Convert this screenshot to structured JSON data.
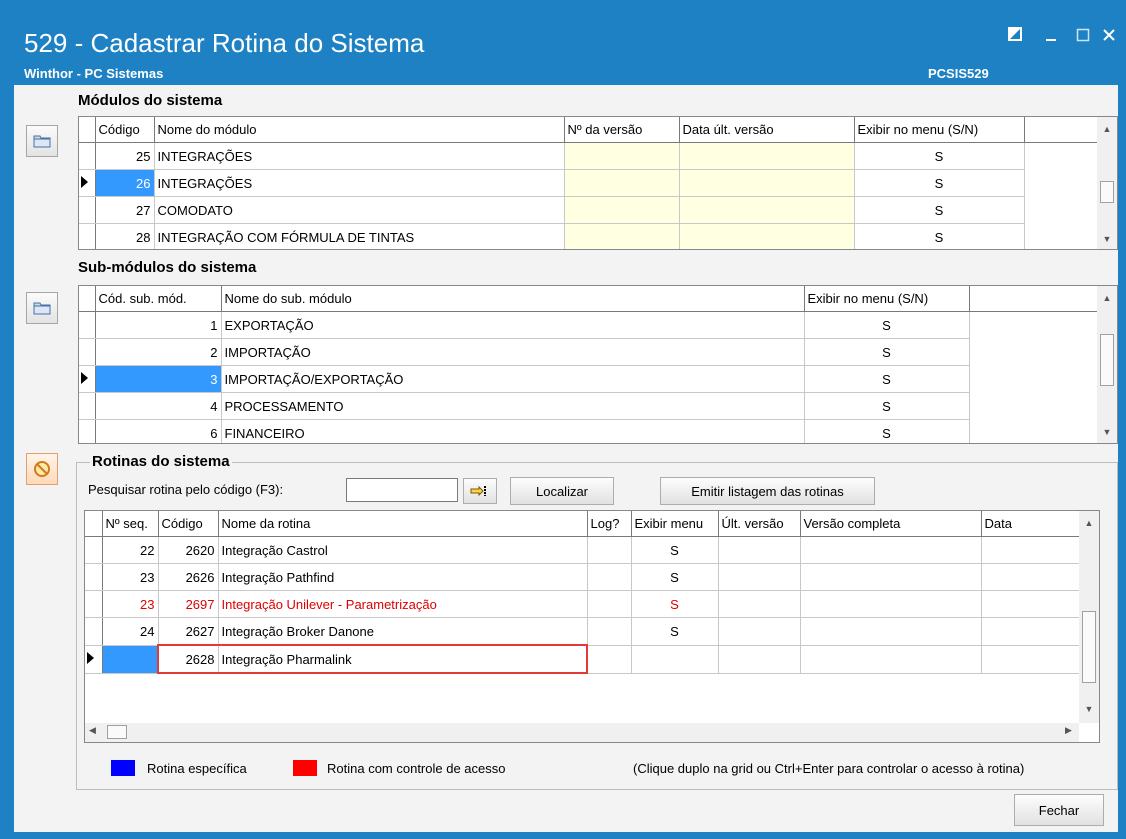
{
  "window": {
    "title": "529 - Cadastrar Rotina do Sistema",
    "subtitle": "Winthor - PC Sistemas",
    "code": "PCSIS529",
    "title_color": "#1d81c4"
  },
  "modulos": {
    "section_title": "Módulos do sistema",
    "columns": [
      "Código",
      "Nome do módulo",
      "Nº da versão",
      "Data últ. versão",
      "Exibir no menu (S/N)"
    ],
    "rows": [
      {
        "codigo": "25",
        "nome": "INTEGRAÇÕES",
        "versao": "",
        "data": "",
        "exibir": "S"
      },
      {
        "codigo": "26",
        "nome": "INTEGRAÇÕES",
        "versao": "",
        "data": "",
        "exibir": "S"
      },
      {
        "codigo": "27",
        "nome": "COMODATO",
        "versao": "",
        "data": "",
        "exibir": "S"
      },
      {
        "codigo": "28",
        "nome": "INTEGRAÇÃO COM FÓRMULA DE TINTAS",
        "versao": "",
        "data": "",
        "exibir": "S"
      }
    ]
  },
  "submodulos": {
    "section_title": "Sub-módulos do sistema",
    "columns": [
      "Cód. sub. mód.",
      "Nome do sub. módulo",
      "Exibir no menu (S/N)"
    ],
    "rows": [
      {
        "codigo": "1",
        "nome": "EXPORTAÇÃO",
        "exibir": "S"
      },
      {
        "codigo": "2",
        "nome": "IMPORTAÇÃO",
        "exibir": "S"
      },
      {
        "codigo": "3",
        "nome": "IMPORTAÇÃO/EXPORTAÇÃO",
        "exibir": "S"
      },
      {
        "codigo": "4",
        "nome": "PROCESSAMENTO",
        "exibir": "S"
      },
      {
        "codigo": "6",
        "nome": "FINANCEIRO",
        "exibir": "S"
      }
    ]
  },
  "rotinas": {
    "section_title": "Rotinas do sistema",
    "search_label": "Pesquisar rotina pelo código (F3):",
    "search_value": "",
    "localizar_label": "Localizar",
    "emitir_label": "Emitir listagem das rotinas",
    "columns": [
      "Nº seq.",
      "Código",
      "Nome da rotina",
      "Log?",
      "Exibir menu",
      "Últ. versão",
      "Versão completa",
      "Data"
    ],
    "rows": [
      {
        "seq": "22",
        "codigo": "2620",
        "nome": "Integração Castrol",
        "log": "",
        "exibir": "S",
        "ult": "",
        "completa": "",
        "data": ""
      },
      {
        "seq": "23",
        "codigo": "2626",
        "nome": "Integração Pathfind",
        "log": "",
        "exibir": "S",
        "ult": "",
        "completa": "",
        "data": ""
      },
      {
        "seq": "23",
        "codigo": "2697",
        "nome": "Integração Unilever - Parametrização",
        "log": "",
        "exibir": "S",
        "ult": "",
        "completa": "",
        "data": ""
      },
      {
        "seq": "24",
        "codigo": "2627",
        "nome": "Integração Broker Danone",
        "log": "",
        "exibir": "S",
        "ult": "",
        "completa": "",
        "data": ""
      },
      {
        "seq": "",
        "codigo": "2628",
        "nome": "Integração Pharmalink",
        "log": "",
        "exibir": "",
        "ult": "",
        "completa": "",
        "data": ""
      }
    ]
  },
  "legend": {
    "especifica": "Rotina específica",
    "especifica_color": "#0000ff",
    "controle": "Rotina com controle de acesso",
    "controle_color": "#ff0000",
    "hint": "(Clique duplo na grid ou Ctrl+Enter para controlar o acesso à rotina)"
  },
  "footer": {
    "fechar_label": "Fechar"
  }
}
